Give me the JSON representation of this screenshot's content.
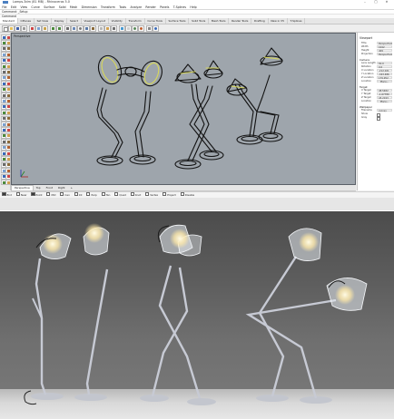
{
  "app": {
    "title": "Lamps.3dm (81 MB) - Rhinoceros 5.0",
    "window_buttons": [
      "–",
      "□",
      "✕"
    ]
  },
  "menu": [
    "File",
    "Edit",
    "View",
    "Curve",
    "Surface",
    "Solid",
    "Mesh",
    "Dimension",
    "Transform",
    "Tools",
    "Analyze",
    "Render",
    "Panels",
    "T-Splines",
    "Help"
  ],
  "command": {
    "history": "Command: _Setup",
    "prompt": "Command"
  },
  "toolbar_tabs": {
    "active": "Standard",
    "items": [
      "Standard",
      "CPlanes",
      "Set View",
      "Display",
      "Select",
      "Viewport Layout",
      "Visibility",
      "Transform",
      "Curve Tools",
      "Surface Tools",
      "Solid Tools",
      "Mesh Tools",
      "Render Tools",
      "Drafting",
      "New in V5",
      "T-Splines"
    ]
  },
  "viewport": {
    "label": "Perspective",
    "background_color": "#9ea5ac",
    "wire_color": "#121212",
    "highlight_color": "#d8d85a"
  },
  "view_tabs": {
    "active": "Perspective",
    "items": [
      "Perspective",
      "Top",
      "Front",
      "Right"
    ]
  },
  "osnaps": [
    {
      "label": "End",
      "on": true
    },
    {
      "label": "Near",
      "on": false
    },
    {
      "label": "Point",
      "on": true
    },
    {
      "label": "Mid",
      "on": false
    },
    {
      "label": "Cen",
      "on": false
    },
    {
      "label": "Int",
      "on": false
    },
    {
      "label": "Perp",
      "on": false
    },
    {
      "label": "Tan",
      "on": false
    },
    {
      "label": "Quad",
      "on": false
    },
    {
      "label": "Knot",
      "on": false
    },
    {
      "label": "Vertex",
      "on": false
    },
    {
      "label": "Project",
      "on": false
    },
    {
      "label": "Disable",
      "on": false
    }
  ],
  "properties": {
    "title": "Viewport",
    "rows": [
      {
        "key": "Title",
        "value": "Perspective"
      },
      {
        "key": "Width",
        "value": "1042"
      },
      {
        "key": "Height",
        "value": "409"
      },
      {
        "key": "Projection",
        "value": "Perspective"
      }
    ],
    "camera_title": "Camera",
    "camera_rows": [
      {
        "key": "Lens Length",
        "value": "50.0"
      },
      {
        "key": "Rotation",
        "value": "0.0"
      },
      {
        "key": "X Location",
        "value": "-212.021"
      },
      {
        "key": "Y Location",
        "value": "-343.486"
      },
      {
        "key": "Z Location",
        "value": "179.952"
      },
      {
        "key": "Location",
        "value": "Place..."
      }
    ],
    "target_title": "Target",
    "target_rows": [
      {
        "key": "X Target",
        "value": "48.5482"
      },
      {
        "key": "Y Target",
        "value": "-1.67780"
      },
      {
        "key": "Z Target",
        "value": "43.2193"
      },
      {
        "key": "Location",
        "value": "Place..."
      }
    ],
    "wallpaper_title": "Wallpaper",
    "wallpaper_rows": [
      {
        "key": "Filename",
        "value": "(none)"
      },
      {
        "key": "Show",
        "check": true
      },
      {
        "key": "Gray",
        "check": true
      }
    ]
  },
  "photo": {
    "wall_color": "#5e5e5e",
    "floor_color": "#d8d8d8",
    "stand_color": "#c9ccd6",
    "shade_color": "#e9eef3",
    "bulb_color": "#fff8dc"
  }
}
